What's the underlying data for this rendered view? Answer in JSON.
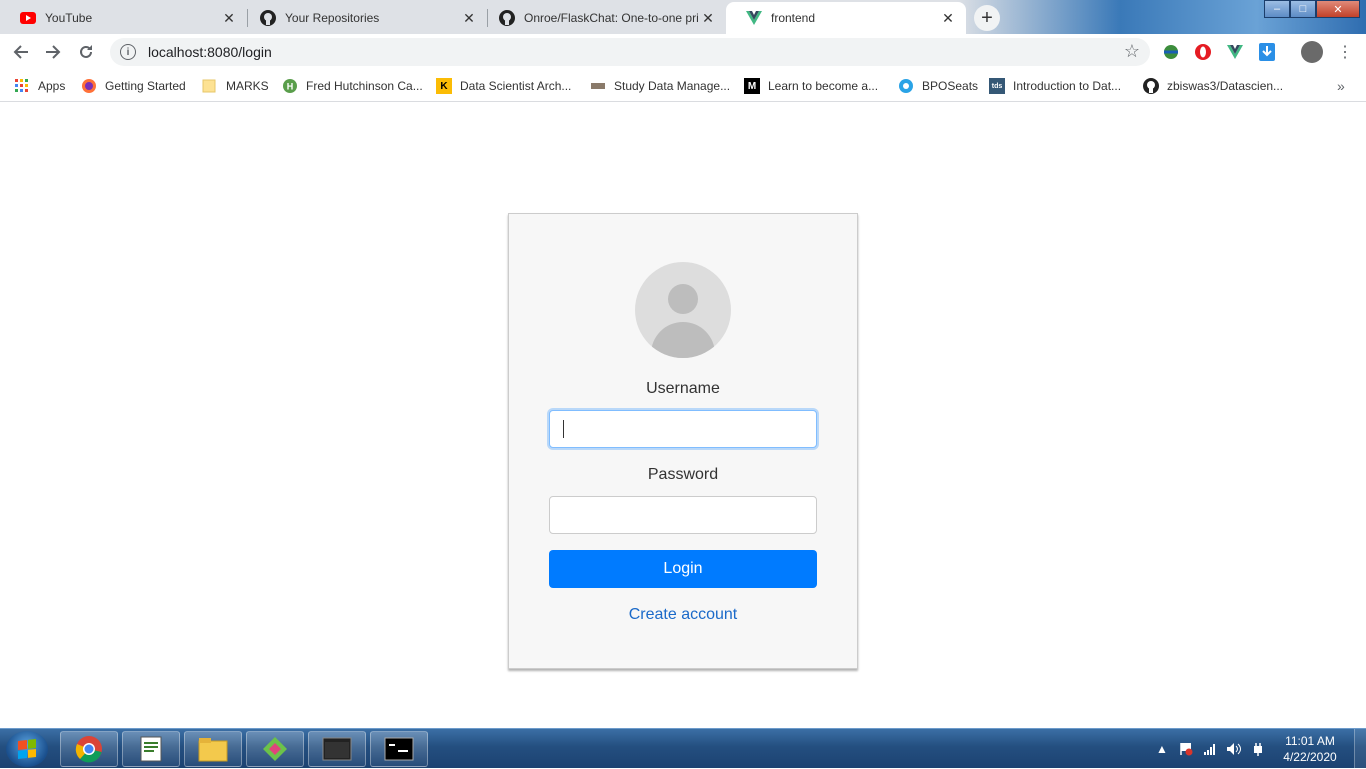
{
  "tabs": [
    {
      "title": "YouTube",
      "icon": "youtube-icon",
      "active": false
    },
    {
      "title": "Your Repositories",
      "icon": "github-icon",
      "active": false
    },
    {
      "title": "Onroe/FlaskChat: One-to-one pri",
      "icon": "github-icon",
      "active": false
    },
    {
      "title": "frontend",
      "icon": "vue-icon",
      "active": true
    }
  ],
  "tab_close": "✕",
  "new_tab": "+",
  "window": {
    "minimize": "–",
    "maximize": "□",
    "close": "✕"
  },
  "address": {
    "url": "localhost:8080/login"
  },
  "bookmarks": [
    {
      "label": "Apps"
    },
    {
      "label": "Getting Started"
    },
    {
      "label": "MARKS"
    },
    {
      "label": "Fred Hutchinson Ca..."
    },
    {
      "label": "Data Scientist Arch..."
    },
    {
      "label": "Study Data Manage..."
    },
    {
      "label": "Learn to become a..."
    },
    {
      "label": "BPOSeats"
    },
    {
      "label": "Introduction to Dat..."
    },
    {
      "label": "zbiswas3/Datascien..."
    }
  ],
  "bookmarks_overflow": "»",
  "login": {
    "username_label": "Username",
    "username_value": "",
    "password_label": "Password",
    "password_value": "",
    "login_button": "Login",
    "create_account": "Create account"
  },
  "colors": {
    "primary": "#007bff",
    "link": "#1b6ac9",
    "card_bg": "#f7f7f7"
  },
  "taskbar": {
    "apps": [
      "chrome-icon",
      "notepad-icon",
      "file-explorer-icon",
      "git-icon",
      "terminal-icon",
      "cmd-icon"
    ],
    "time": "11:01 AM",
    "date": "4/22/2020"
  }
}
